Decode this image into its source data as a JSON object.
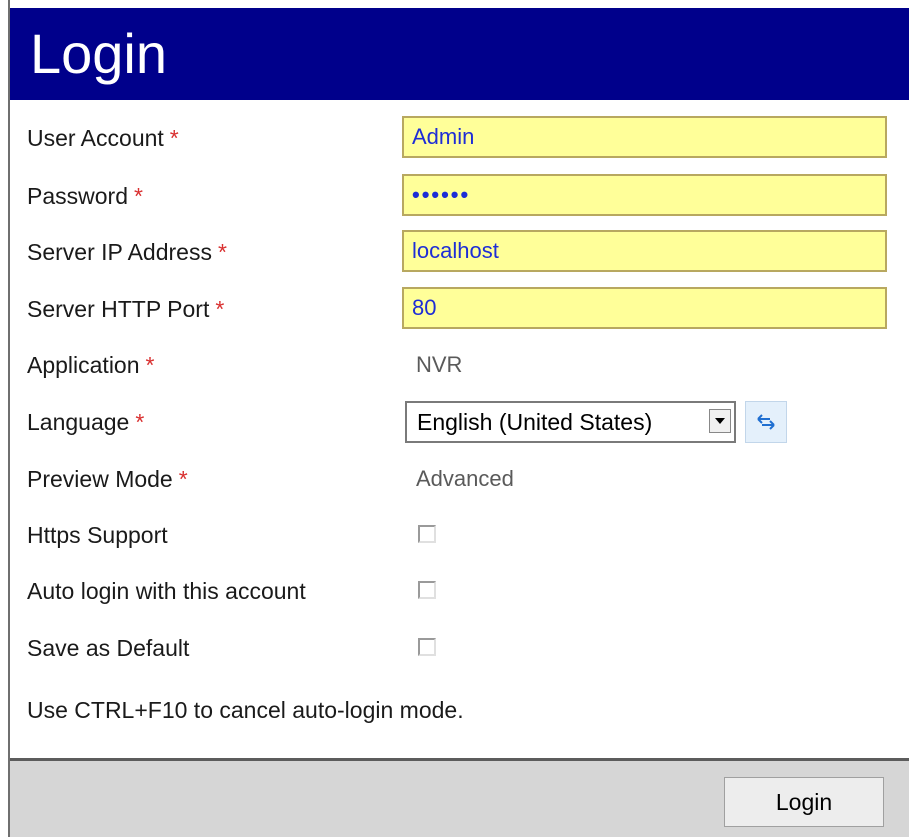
{
  "window": {
    "title": "Login"
  },
  "form": {
    "user_account": {
      "label": "User Account",
      "required_mark": "*",
      "value": "Admin"
    },
    "password": {
      "label": "Password",
      "required_mark": "*",
      "value": "••••••"
    },
    "server_ip": {
      "label": "Server IP Address",
      "required_mark": "*",
      "value": "localhost"
    },
    "server_port": {
      "label": "Server HTTP Port",
      "required_mark": "*",
      "value": "80"
    },
    "application": {
      "label": "Application",
      "required_mark": "*",
      "value": "NVR"
    },
    "language": {
      "label": "Language",
      "required_mark": "*",
      "selected": "English (United States)"
    },
    "preview_mode": {
      "label": "Preview Mode",
      "required_mark": "*",
      "value": "Advanced"
    },
    "https_support": {
      "label": "Https Support",
      "checked": false
    },
    "auto_login": {
      "label": "Auto login with this account",
      "checked": false
    },
    "save_default": {
      "label": "Save as Default",
      "checked": false
    }
  },
  "hint": "Use CTRL+F10 to cancel auto-login mode.",
  "footer": {
    "login_label": "Login"
  },
  "icons": {
    "refresh": "refresh-icon",
    "dropdown": "chevron-down-icon"
  },
  "colors": {
    "title_bar": "#00008b",
    "field_background": "#ffff99",
    "field_text": "#1e2dd6",
    "required": "#d93030"
  }
}
